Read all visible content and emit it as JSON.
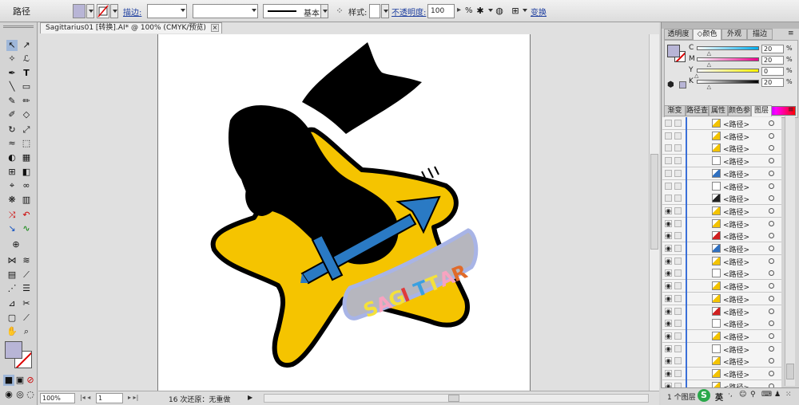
{
  "control_bar": {
    "object_type": "路径",
    "stroke_label": "描边:",
    "stroke_profile": "基本",
    "style_label": "样式:",
    "opacity_label": "不透明度:",
    "opacity_value": "100",
    "opacity_unit": "%",
    "transform_label": "变换"
  },
  "document": {
    "tab_title": "Sagittarius01 [转换].AI* @ 100% (CMYK/预览)",
    "tab_close": "×"
  },
  "status": {
    "zoom": "100%",
    "artboard": "1",
    "info": "16 次还原：无重做"
  },
  "color_panel": {
    "tabs": [
      "透明度",
      "颜色",
      "外观",
      "描边"
    ],
    "active_tab": "颜色",
    "channels": [
      {
        "label": "C",
        "value": "20",
        "gradient": "#ffffff,#00aeef"
      },
      {
        "label": "M",
        "value": "20",
        "gradient": "#ffffff,#ec008c"
      },
      {
        "label": "Y",
        "value": "0",
        "gradient": "#ffffff,#fff200"
      },
      {
        "label": "K",
        "value": "20",
        "gradient": "#ffffff,#000000"
      }
    ],
    "fill_color": "#b8b5d6"
  },
  "layers_panel": {
    "tabs": [
      "渐变",
      "路径查",
      "属性",
      "颜色参",
      "图层"
    ],
    "active_tab": "图层",
    "row_label": "<路径>",
    "rows": [
      {
        "eye": false,
        "thumb": "#f3c300"
      },
      {
        "eye": false,
        "thumb": "#f3c300"
      },
      {
        "eye": false,
        "thumb": "#f3c300"
      },
      {
        "eye": false,
        "thumb": "#ffffff"
      },
      {
        "eye": false,
        "thumb": "#3070c0"
      },
      {
        "eye": false,
        "thumb": "#ffffff"
      },
      {
        "eye": false,
        "thumb": "#222222"
      },
      {
        "eye": true,
        "thumb": "#f3c300"
      },
      {
        "eye": true,
        "thumb": "#f3c300"
      },
      {
        "eye": true,
        "thumb": "#d02020"
      },
      {
        "eye": true,
        "thumb": "#3070c0"
      },
      {
        "eye": true,
        "thumb": "#f3c300"
      },
      {
        "eye": true,
        "thumb": "#ffffff"
      },
      {
        "eye": true,
        "thumb": "#f3c300"
      },
      {
        "eye": true,
        "thumb": "#f3c300"
      },
      {
        "eye": true,
        "thumb": "#d02020"
      },
      {
        "eye": true,
        "thumb": "#ffffff"
      },
      {
        "eye": true,
        "thumb": "#f3c300"
      },
      {
        "eye": true,
        "thumb": "#ffffff"
      },
      {
        "eye": true,
        "thumb": "#f3c300"
      },
      {
        "eye": true,
        "thumb": "#f3c300"
      },
      {
        "eye": true,
        "thumb": "#f3c300"
      }
    ],
    "footer": "1 个图层"
  },
  "artwork": {
    "banner_text": "SAGITTAR",
    "letter_colors": [
      "#f4e13a",
      "#f7a3c0",
      "#f4e13a",
      "#e03a3a",
      "#3aa0e0",
      "#f4e13a",
      "#f7a3c0",
      "#e06a2a"
    ]
  },
  "ime": {
    "label": "英"
  }
}
